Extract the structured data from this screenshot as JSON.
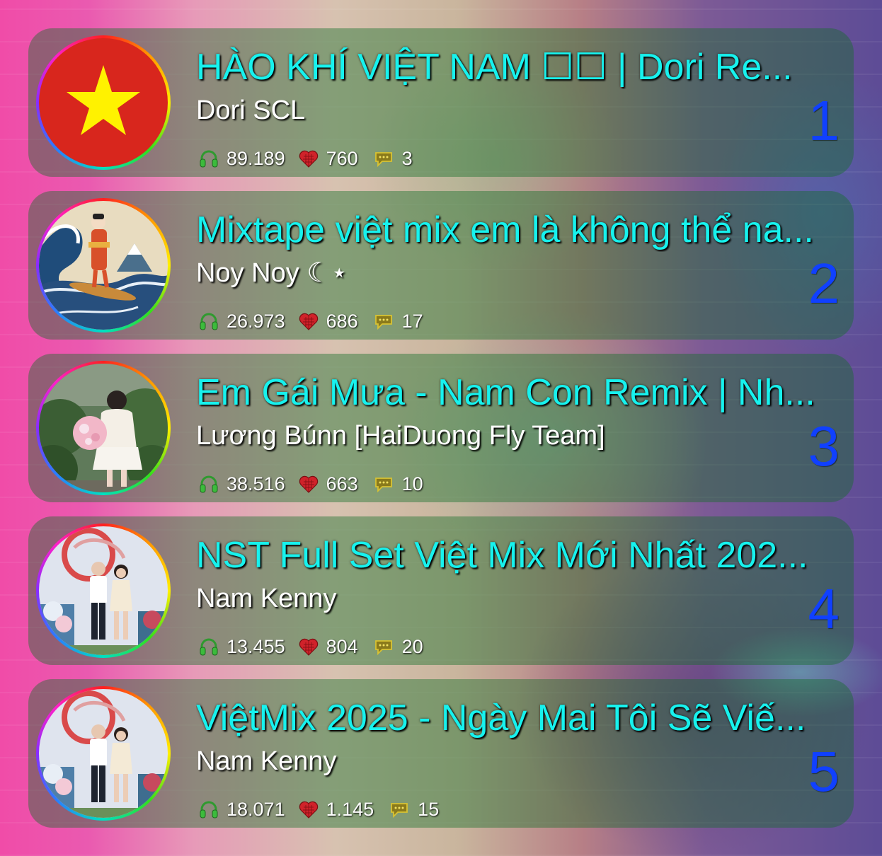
{
  "tracks": [
    {
      "rank": "1",
      "title": "HÀO KHÍ VIỆT NAM ☐☐ | Dori Re...",
      "artist": "Dori SCL",
      "plays": "89.189",
      "likes": "760",
      "comments": "3",
      "avatar": "vietnam-flag-avatar"
    },
    {
      "rank": "2",
      "title": "Mixtape việt mix em là không thể na...",
      "artist": "Noy Noy ☾⋆",
      "plays": "26.973",
      "likes": "686",
      "comments": "17",
      "avatar": "great-wave-surfer-avatar"
    },
    {
      "rank": "3",
      "title": "Em Gái Mưa - Nam Con Remix | Nh...",
      "artist": "Lương Búnn [HaiDuong Fly Team]",
      "plays": "38.516",
      "likes": "663",
      "comments": "10",
      "avatar": "girl-with-bouquet-avatar"
    },
    {
      "rank": "4",
      "title": "NST Full Set Việt Mix Mới Nhất 202...",
      "artist": "Nam Kenny",
      "plays": "13.455",
      "likes": "804",
      "comments": "20",
      "avatar": "couple-photo-avatar"
    },
    {
      "rank": "5",
      "title": "ViệtMix 2025 - Ngày Mai Tôi Sẽ Viế...",
      "artist": "Nam Kenny",
      "plays": "18.071",
      "likes": "1.145",
      "comments": "15",
      "avatar": "couple-photo-avatar"
    }
  ],
  "icons": {
    "plays": "headphones-icon",
    "likes": "heart-icon",
    "comments": "speech-bubble-icon"
  },
  "colors": {
    "title": "#17f2ee",
    "artist": "#ffffff",
    "rank": "#1040ff",
    "card": "#146e28"
  }
}
